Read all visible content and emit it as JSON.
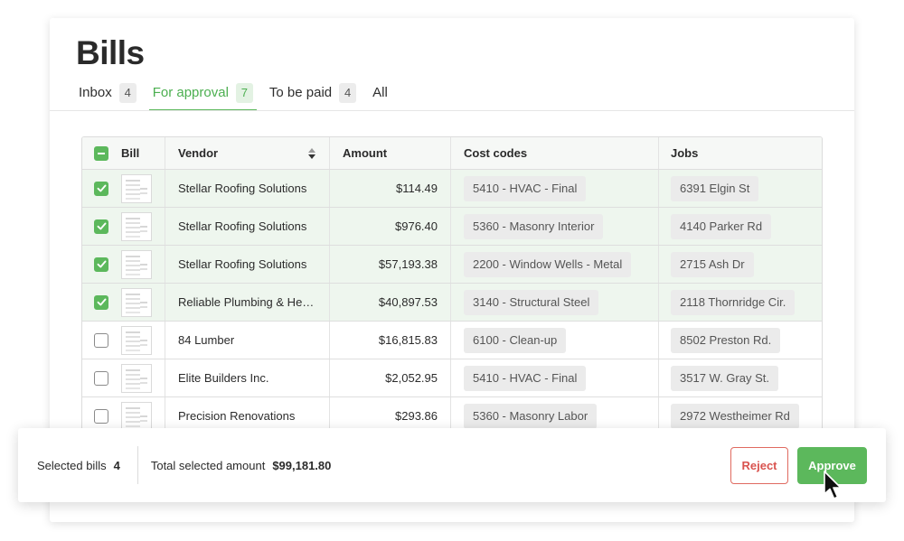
{
  "page": {
    "title": "Bills"
  },
  "tabs": [
    {
      "label": "Inbox",
      "count": "4"
    },
    {
      "label": "For approval",
      "count": "7"
    },
    {
      "label": "To be paid",
      "count": "4"
    },
    {
      "label": "All",
      "count": ""
    }
  ],
  "active_tab": "For approval",
  "table": {
    "headers": {
      "bill": "Bill",
      "vendor": "Vendor",
      "amount": "Amount",
      "cost_codes": "Cost codes",
      "jobs": "Jobs"
    },
    "rows": [
      {
        "selected": true,
        "vendor": "Stellar Roofing Solutions",
        "amount": "$114.49",
        "cost_code": "5410 - HVAC - Final",
        "job": "6391 Elgin St"
      },
      {
        "selected": true,
        "vendor": "Stellar Roofing Solutions",
        "amount": "$976.40",
        "cost_code": "5360 - Masonry Interior",
        "job": "4140 Parker Rd"
      },
      {
        "selected": true,
        "vendor": "Stellar Roofing Solutions",
        "amount": "$57,193.38",
        "cost_code": "2200 - Window Wells - Metal",
        "job": "2715 Ash Dr"
      },
      {
        "selected": true,
        "vendor": "Reliable Plumbing & Heati...",
        "amount": "$40,897.53",
        "cost_code": "3140 - Structural Steel",
        "job": "2118 Thornridge Cir."
      },
      {
        "selected": false,
        "vendor": "84 Lumber",
        "amount": "$16,815.83",
        "cost_code": "6100 - Clean-up",
        "job": "8502 Preston Rd."
      },
      {
        "selected": false,
        "vendor": "Elite Builders Inc.",
        "amount": "$2,052.95",
        "cost_code": "5410 - HVAC - Final",
        "job": "3517 W. Gray St."
      },
      {
        "selected": false,
        "vendor": "Precision Renovations",
        "amount": "$293.86",
        "cost_code": "5360 - Masonry Labor",
        "job": "2972 Westheimer Rd"
      }
    ]
  },
  "footer": {
    "selected_label": "Selected bills",
    "selected_count": "4",
    "total_label": "Total selected amount",
    "total_amount": "$99,181.80",
    "reject_label": "Reject",
    "approve_label": "Approve"
  },
  "colors": {
    "accent": "#5cb85c",
    "reject": "#d9534f",
    "selected_row": "#eef6ee"
  }
}
